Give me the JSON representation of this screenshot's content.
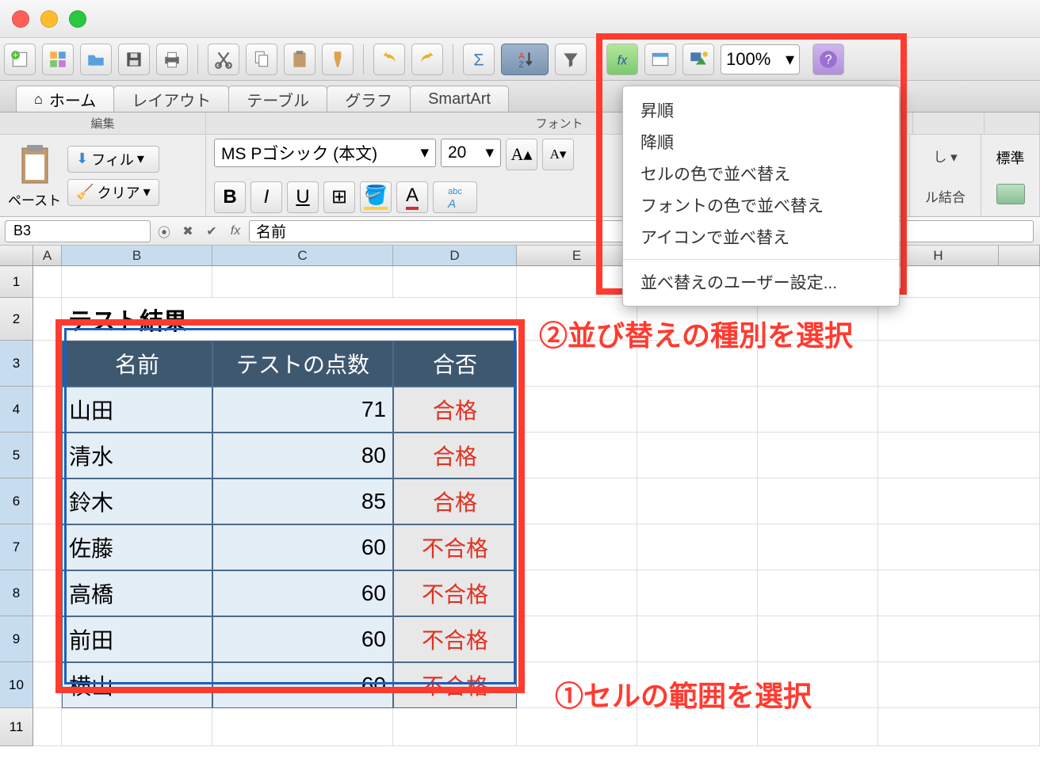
{
  "window": {
    "zoom": "100%"
  },
  "tabs": {
    "home": "ホーム",
    "layout": "レイアウト",
    "tables": "テーブル",
    "charts": "グラフ",
    "smartart": "SmartArt"
  },
  "groups": {
    "edit": "編集",
    "font": "フォント",
    "merge": "ル結合",
    "numfmt": "標準"
  },
  "edit": {
    "paste": "ペースト",
    "fill": "フィル",
    "clear": "クリア"
  },
  "font": {
    "name": "MS Pゴシック (本文)",
    "size": "20"
  },
  "formula": {
    "ref": "B3",
    "value": "名前"
  },
  "cols": [
    "A",
    "B",
    "C",
    "D",
    "E",
    "H"
  ],
  "sheet": {
    "title": "テスト結果",
    "headers": {
      "name": "名前",
      "score": "テストの点数",
      "result": "合否"
    },
    "rows": [
      {
        "name": "山田",
        "score": 71,
        "result": "合格"
      },
      {
        "name": "清水",
        "score": 80,
        "result": "合格"
      },
      {
        "name": "鈴木",
        "score": 85,
        "result": "合格"
      },
      {
        "name": "佐藤",
        "score": 60,
        "result": "不合格"
      },
      {
        "name": "高橋",
        "score": 60,
        "result": "不合格"
      },
      {
        "name": "前田",
        "score": 60,
        "result": "不合格"
      },
      {
        "name": "横山",
        "score": 60,
        "result": "不合格"
      }
    ]
  },
  "dropdown": {
    "asc": "昇順",
    "desc": "降順",
    "cell_color": "セルの色で並べ替え",
    "font_color": "フォントの色で並べ替え",
    "icon": "アイコンで並べ替え",
    "custom": "並べ替えのユーザー設定..."
  },
  "anno": {
    "one": "①セルの範囲を選択",
    "two": "②並び替えの種別を選択"
  }
}
